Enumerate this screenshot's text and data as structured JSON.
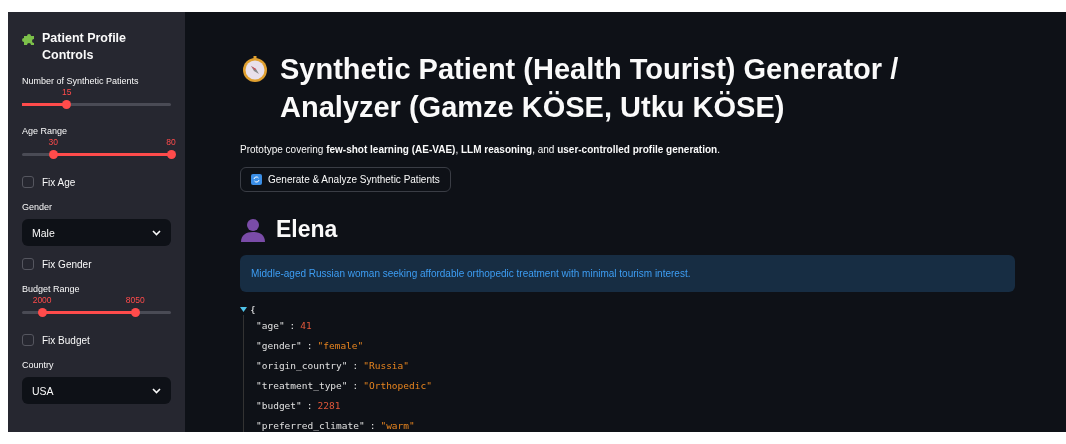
{
  "sidebar": {
    "title": "Patient Profile Controls",
    "controls": [
      {
        "kind": "slider",
        "label": "Number of Synthetic Patients",
        "thumbs": [
          {
            "value": "15",
            "level": 0.3
          }
        ]
      },
      {
        "kind": "slider",
        "label": "Age Range",
        "thumbs": [
          {
            "value": "30",
            "level": 0.21
          },
          {
            "value": "80",
            "level": 1
          }
        ]
      },
      {
        "kind": "checkbox",
        "label": "Fix Age",
        "checked": false
      },
      {
        "kind": "select",
        "label": "Gender",
        "value": "Male"
      },
      {
        "kind": "checkbox",
        "label": "Fix Gender",
        "checked": false
      },
      {
        "kind": "slider",
        "label": "Budget Range",
        "thumbs": [
          {
            "value": "2000",
            "level": 0.135
          },
          {
            "value": "8050",
            "level": 0.76
          }
        ]
      },
      {
        "kind": "checkbox",
        "label": "Fix Budget",
        "checked": false
      },
      {
        "kind": "select",
        "label": "Country",
        "value": "USA"
      }
    ]
  },
  "main": {
    "title": "Synthetic Patient (Health Tourist) Generator / Analyzer (Gamze KÖSE, Utku KÖSE)",
    "caption": "Prototype covering **few-shot learning (AE-VAE)**, **LLM reasoning**, and **user-controlled profile generation**.",
    "button": "Generate & Analyze Synthetic Patients",
    "patient_name": "Elena",
    "info": "Middle-aged Russian woman seeking affordable orthopedic treatment with minimal tourism interest.",
    "json_view": {
      "expanded": true,
      "open_brace": "{",
      "fields": [
        {
          "key": "\"age\"",
          "sep": ":",
          "value": "41",
          "kind": "number"
        },
        {
          "key": "\"gender\"",
          "sep": ":",
          "value": "\"female\"",
          "kind": "string"
        },
        {
          "key": "\"origin_country\"",
          "sep": ":",
          "value": "\"Russia\"",
          "kind": "string"
        },
        {
          "key": "\"treatment_type\"",
          "sep": ":",
          "value": "\"Orthopedic\"",
          "kind": "string"
        },
        {
          "key": "\"budget\"",
          "sep": ":",
          "value": "2281",
          "kind": "number"
        },
        {
          "key": "\"preferred_climate\"",
          "sep": ":",
          "value": "\"warm\"",
          "kind": "string"
        }
      ]
    }
  }
}
